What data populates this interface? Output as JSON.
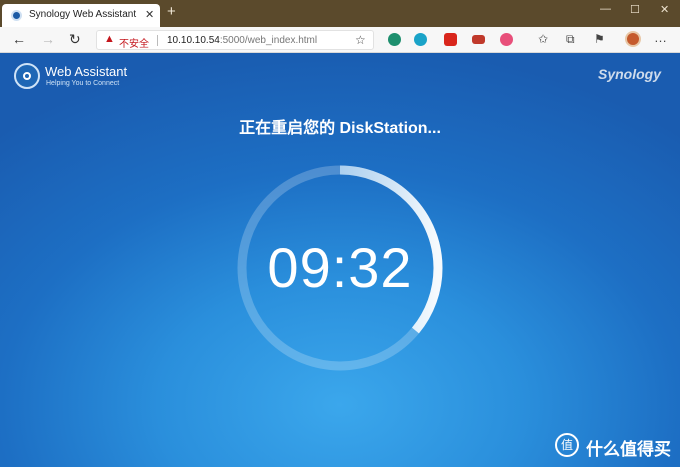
{
  "browser": {
    "tab_title": "Synology Web Assistant",
    "url_security": "不安全",
    "url_host": "10.10.10.54",
    "url_rest": ":5000/web_index.html"
  },
  "page": {
    "logo_title": "Web Assistant",
    "logo_subtitle": "Helping You to Connect",
    "brand": "Synology",
    "status_text": "正在重启您的 DiskStation...",
    "timer": "09:32",
    "countdown_progress_fraction": 0.36
  },
  "watermark": {
    "text": "值 什么值得买",
    "icon": "zhi-icon"
  }
}
